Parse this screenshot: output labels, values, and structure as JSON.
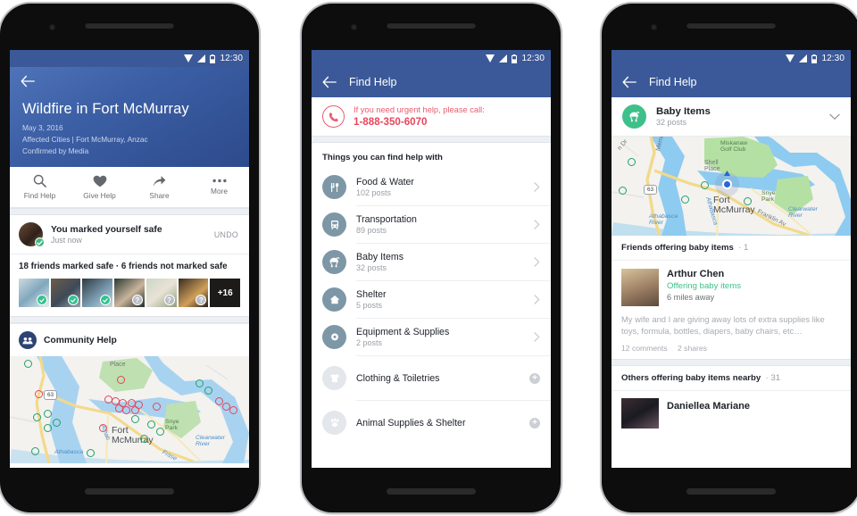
{
  "statusbar": {
    "time": "12:30",
    "icons": [
      "wifi-icon",
      "signal-icon",
      "battery-icon"
    ]
  },
  "colors": {
    "fb_blue": "#3b5998",
    "hero_blue_light": "#4f73b8",
    "hero_blue_dark": "#2d4a8c",
    "safe_green": "#35c290",
    "category_icon": "#7d97a6",
    "alert_red": "#e8455c",
    "baby_green": "#3fc08b"
  },
  "phone1": {
    "hero": {
      "title": "Wildfire in Fort McMurray",
      "date": "May 3, 2016",
      "cities": "Affected Cities | Fort McMurray, Anzac",
      "source": "Confirmed by Media"
    },
    "actions": [
      {
        "label": "Find Help",
        "icon": "search-icon"
      },
      {
        "label": "Give Help",
        "icon": "heart-icon"
      },
      {
        "label": "Share",
        "icon": "share-icon"
      },
      {
        "label": "More",
        "icon": "ellipsis-icon"
      }
    ],
    "safe": {
      "title": "You marked yourself safe",
      "subtitle": "Just now",
      "undo": "UNDO"
    },
    "friends": {
      "summary": "18 friends marked safe · 6 friends not marked safe",
      "thumbs": [
        {
          "state": "safe"
        },
        {
          "state": "safe"
        },
        {
          "state": "safe"
        },
        {
          "state": "unknown"
        },
        {
          "state": "unknown"
        },
        {
          "state": "unknown"
        },
        {
          "state": "more",
          "label": "+16"
        }
      ]
    },
    "community": {
      "label": "Community Help",
      "icon": "community-icon"
    },
    "map": {
      "city": "Fort\nMcMurray",
      "labels": [
        "Place",
        "Snye Park",
        "Clearwater River",
        "Athabasca",
        "Frase"
      ],
      "highway": "63"
    }
  },
  "phone2": {
    "appbar": {
      "title": "Find Help",
      "back": "back-arrow-icon"
    },
    "urgent": {
      "line1": "If you need urgent help, please call:",
      "phone": "1-888-350-6070",
      "icon": "phone-icon"
    },
    "section_title": "Things you can find help with",
    "categories": [
      {
        "name": "Food & Water",
        "posts": "102 posts",
        "icon": "utensils-icon",
        "enabled": true
      },
      {
        "name": "Transportation",
        "posts": "89 posts",
        "icon": "bus-icon",
        "enabled": true
      },
      {
        "name": "Baby Items",
        "posts": "32 posts",
        "icon": "stroller-icon",
        "enabled": true
      },
      {
        "name": "Shelter",
        "posts": "5 posts",
        "icon": "home-icon",
        "enabled": true
      },
      {
        "name": "Equipment & Supplies",
        "posts": "2 posts",
        "icon": "gear-icon",
        "enabled": true
      },
      {
        "name": "Clothing & Toiletries",
        "posts": "",
        "icon": "shirt-icon",
        "enabled": false
      },
      {
        "name": "Animal Supplies & Shelter",
        "posts": "",
        "icon": "paw-icon",
        "enabled": false
      }
    ]
  },
  "phone3": {
    "appbar": {
      "title": "Find Help",
      "back": "back-arrow-icon"
    },
    "category": {
      "name": "Baby Items",
      "posts": "32 posts",
      "icon": "stroller-icon",
      "chevron": "chevron-down-icon"
    },
    "map": {
      "city": "Fort\nMcMurray",
      "labels": [
        "Miskanaw Golf Club",
        "Shell Place",
        "Snye Park",
        "Clearwater River",
        "Athabasca River",
        "Athabasca",
        "Franklin Av",
        "Memor",
        "n Dr",
        "Pr"
      ],
      "highway": "63"
    },
    "friends_section": {
      "label": "Friends offering baby items",
      "count": "1"
    },
    "post": {
      "name": "Arthur Chen",
      "status": "Offering baby items",
      "distance": "6 miles away",
      "body": "My wife and I are giving away lots of extra supplies like toys, formula, bottles, diapers, baby chairs, etc…",
      "comments": "12 comments",
      "shares": "2 shares"
    },
    "others_section": {
      "label": "Others offering baby items nearby",
      "count": "31"
    },
    "post2": {
      "name": "Daniellea Mariane"
    }
  }
}
